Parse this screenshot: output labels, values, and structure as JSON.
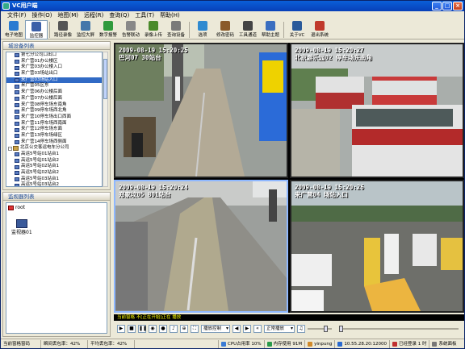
{
  "window": {
    "title": "VC用户端"
  },
  "menu": [
    "文件(F)",
    "操作(O)",
    "地图(M)",
    "远程(R)",
    "查询(Q)",
    "工具(T)",
    "帮助(H)"
  ],
  "toolbar": [
    {
      "label": "电子地图",
      "icon": "map-icon",
      "color": "#2a7bd1"
    },
    {
      "label": "监控器",
      "icon": "monitor-icon",
      "color": "#3b5fa8",
      "active": true
    },
    {
      "label": "路径录像",
      "icon": "record-icon",
      "color": "#555555"
    },
    {
      "label": "监控大屏",
      "icon": "screen-icon",
      "color": "#4477aa"
    },
    {
      "label": "数字报警",
      "icon": "refresh-icon",
      "color": "#2f9a3c"
    },
    {
      "label": "告警联动",
      "icon": "alarm-icon",
      "color": "#888888"
    },
    {
      "label": "录像上传",
      "icon": "upload-icon",
      "color": "#4a8a2a"
    },
    {
      "label": "查询设备",
      "icon": "search-icon",
      "color": "#7a7a7a"
    },
    {
      "label": "选项",
      "icon": "options-icon",
      "color": "#2f8ad0"
    },
    {
      "label": "修改密码",
      "icon": "password-icon",
      "color": "#8a5a2a"
    },
    {
      "label": "工具通道",
      "icon": "tools-icon",
      "color": "#444444"
    },
    {
      "label": "帮助主题",
      "icon": "help-icon",
      "color": "#3a6ec0"
    },
    {
      "label": "关于VC",
      "icon": "about-icon",
      "color": "#2a5a9a"
    },
    {
      "label": "退出系统",
      "icon": "exit-icon",
      "color": "#c0392b"
    }
  ],
  "device_panel": {
    "title": "城设备列表",
    "items": [
      {
        "label": "第七分公司口出口",
        "type": "cam"
      },
      {
        "label": "来广营01办公楼区",
        "type": "cam"
      },
      {
        "label": "来广营03办公楼入口",
        "type": "cam"
      },
      {
        "label": "来广营03场站出口",
        "type": "cam"
      },
      {
        "label": "来广营03场站入口",
        "type": "cam",
        "selected": true
      },
      {
        "label": "来广营05区东",
        "type": "cam"
      },
      {
        "label": "来广营06办公楼后面",
        "type": "cam"
      },
      {
        "label": "来广营07办公楼后面",
        "type": "cam"
      },
      {
        "label": "来广营08停车场东南角",
        "type": "cam"
      },
      {
        "label": "来广营09停车场西北角",
        "type": "cam"
      },
      {
        "label": "来广营10停车场出口西面",
        "type": "cam"
      },
      {
        "label": "来广营11停车场西南面",
        "type": "cam"
      },
      {
        "label": "来广营12停车场东面",
        "type": "cam"
      },
      {
        "label": "来广营13停车场绿区",
        "type": "cam"
      },
      {
        "label": "来广营14停车场西侧面",
        "type": "cam"
      },
      {
        "label": "北京公交客运电车分公司",
        "type": "bld",
        "expand": "-"
      },
      {
        "label": "高运5号站01站台1",
        "type": "cam"
      },
      {
        "label": "高运5号站01站台2",
        "type": "cam"
      },
      {
        "label": "高运5号站02站台1",
        "type": "cam"
      },
      {
        "label": "高运5号站02站台2",
        "type": "cam"
      },
      {
        "label": "高运5号站03站台1",
        "type": "cam"
      },
      {
        "label": "高运5号站03站台2",
        "type": "cam"
      }
    ]
  },
  "monitor_panel": {
    "title": "监视器列表",
    "root_label": "root",
    "monitor_label": "监视器01"
  },
  "videos": [
    {
      "stamp_date": "2009-08-19 15:20:25",
      "stamp_place": "巴河07 30站台"
    },
    {
      "stamp_date": "2009-08-19 15:20:27",
      "stamp_place": "北京游乐园02 停车场东南角"
    },
    {
      "stamp_date": "2009-08-19 15:20:24",
      "stamp_place": "郑家坟05 801站台"
    },
    {
      "stamp_date": "2009-08-19 15:20:26",
      "stamp_place": "来广营04 场站入口"
    }
  ],
  "video_status": "当前窗格 不[正在开始]正在 播放",
  "controls": {
    "stream_select": "播放控制",
    "speed_select": "正常播放"
  },
  "statusbar": {
    "device_code": "当前窗格窗码",
    "rx_rate": "瞬间丢包率：42%",
    "avg_rate": "平均丢包率：42%",
    "cpu": "CPU占用率 10%",
    "memory": "内存使用 91M",
    "user": "yinpung",
    "server": "10.55.28.20:12000",
    "login": "已经登录 1 时",
    "settings": "系统面板"
  },
  "colors": {
    "title_bar": "#0a5fd8",
    "selection": "#316ac5",
    "status_text": "#ffff00"
  }
}
